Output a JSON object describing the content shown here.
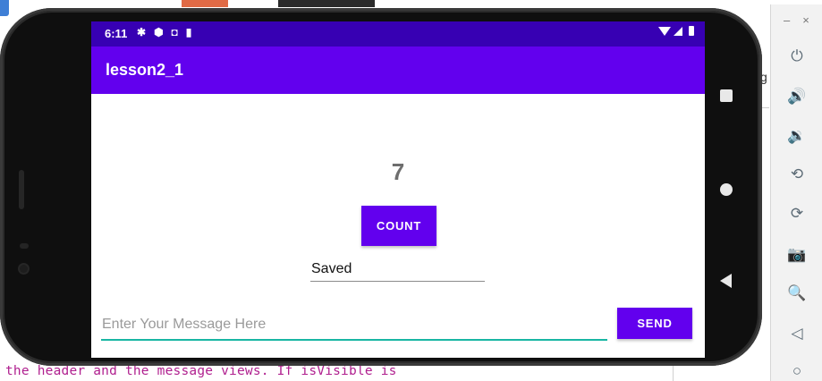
{
  "ide": {
    "code_line": "the header and the message views. If isVisible is",
    "side_text": "g"
  },
  "status_bar": {
    "time": "6:11",
    "icons": [
      "gear-icon",
      "shield-icon",
      "a-icon",
      "sd-card-icon"
    ],
    "right_icons": [
      "wifi-icon",
      "signal-icon",
      "battery-icon"
    ]
  },
  "app": {
    "title": "lesson2_1",
    "count_value": "7",
    "count_button": "COUNT",
    "saved_text": "Saved",
    "message_placeholder": "Enter Your Message Here",
    "message_value": "",
    "send_button": "SEND",
    "colors": {
      "status_bar": "#3700b3",
      "app_bar": "#6200ee",
      "accent_underline": "#19b6a3",
      "button": "#6200ee"
    }
  },
  "device_nav": [
    "recent-apps-icon",
    "home-icon",
    "back-icon"
  ],
  "emulator_toolbar": {
    "window_controls": [
      "–",
      "×"
    ],
    "buttons": [
      "power-icon",
      "volume-up-icon",
      "volume-down-icon",
      "rotate-left-icon",
      "rotate-right-icon",
      "camera-icon",
      "zoom-icon",
      "back-icon",
      "home-icon"
    ]
  }
}
